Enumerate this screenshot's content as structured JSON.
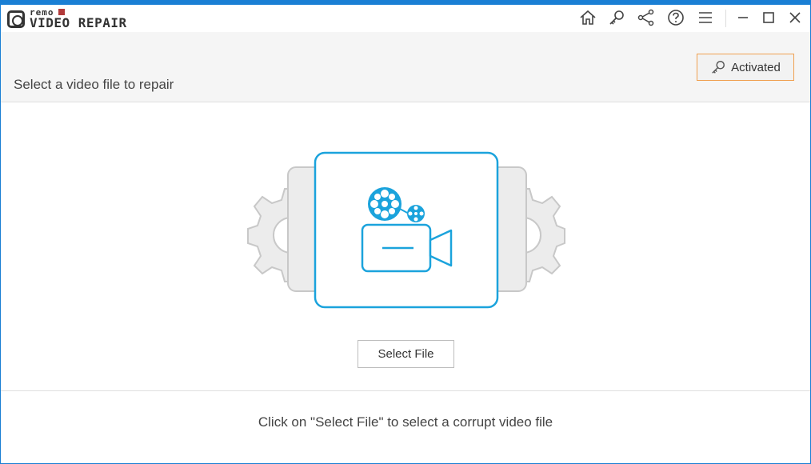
{
  "app": {
    "brand_small": "remo",
    "brand_title": "VIDEO REPAIR"
  },
  "titlebar": {
    "icons": [
      "home-icon",
      "key-icon",
      "share-icon",
      "help-icon",
      "menu-icon",
      "minimize-icon",
      "maximize-icon",
      "close-icon"
    ]
  },
  "header": {
    "title": "Select a video file to repair",
    "activated_label": "Activated"
  },
  "main": {
    "select_label": "Select File",
    "hint": "Click on \"Select File\" to select a corrupt video file"
  },
  "colors": {
    "accent": "#1a7fd4",
    "icon_blue": "#1ba3dc",
    "activated_border": "#f0a050",
    "gear_gray": "#c8c8c8"
  }
}
